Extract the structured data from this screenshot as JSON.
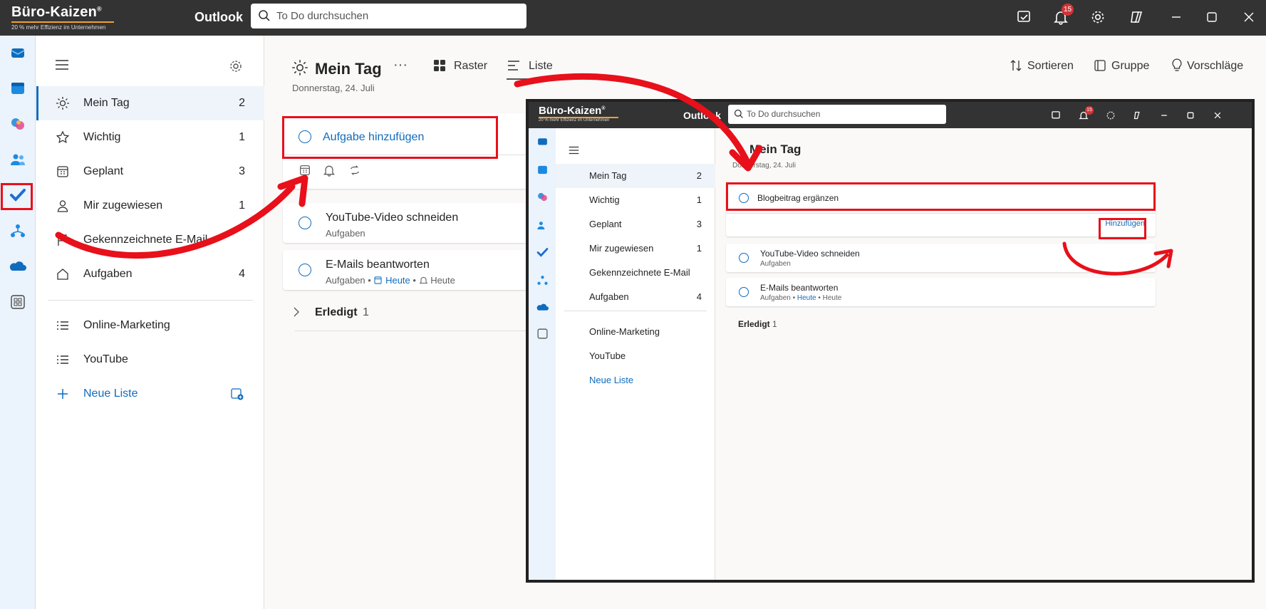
{
  "brand": {
    "name": "Büro-Kaizen",
    "mark": "®",
    "tagline": "20 % mehr Effizienz im Unternehmen"
  },
  "app": {
    "name": "Outlook"
  },
  "search": {
    "placeholder": "To Do durchsuchen"
  },
  "notifications": {
    "count": "15"
  },
  "sidebar": {
    "items": [
      {
        "label": "Mein Tag",
        "count": "2",
        "icon": "sun-icon"
      },
      {
        "label": "Wichtig",
        "count": "1",
        "icon": "star-icon"
      },
      {
        "label": "Geplant",
        "count": "3",
        "icon": "calendar-icon"
      },
      {
        "label": "Mir zugewiesen",
        "count": "1",
        "icon": "person-icon"
      },
      {
        "label": "Gekennzeichnete E-Mail",
        "count": "",
        "icon": "flag-icon"
      },
      {
        "label": "Aufgaben",
        "count": "4",
        "icon": "home-icon"
      }
    ],
    "lists": [
      {
        "label": "Online-Marketing"
      },
      {
        "label": "YouTube"
      }
    ],
    "new_list": "Neue Liste"
  },
  "main": {
    "title": "Mein Tag",
    "date": "Donnerstag, 24. Juli",
    "view_raster": "Raster",
    "view_liste": "Liste",
    "sort": "Sortieren",
    "group": "Gruppe",
    "suggestions": "Vorschläge",
    "add_task": "Aufgabe hinzufügen",
    "tasks": [
      {
        "title": "YouTube-Video schneiden",
        "list": "Aufgaben",
        "due": "",
        "reminder": ""
      },
      {
        "title": "E-Mails beantworten",
        "list": "Aufgaben",
        "due": "Heute",
        "reminder": "Heute"
      }
    ],
    "completed": {
      "label": "Erledigt",
      "count": "1"
    }
  },
  "inset": {
    "input_value": "Blogbeitrag ergänzen",
    "add_button": "Hinzufügen"
  },
  "colors": {
    "accent": "#0f6cbd",
    "annotation": "#e8101a",
    "titlebar": "#333333"
  }
}
